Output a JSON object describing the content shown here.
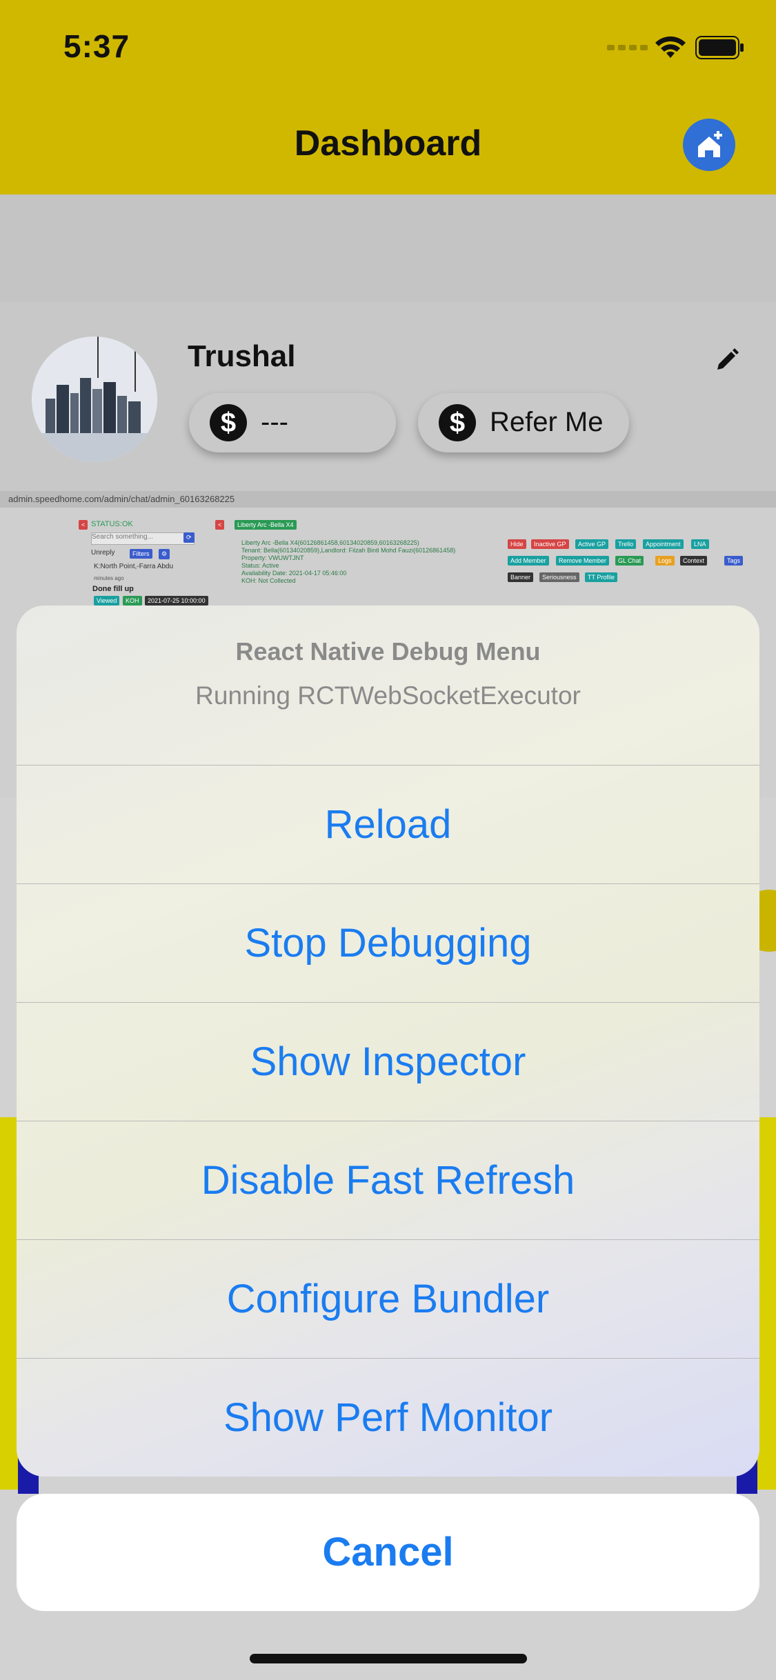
{
  "status_bar": {
    "time": "5:37"
  },
  "header": {
    "title": "Dashboard",
    "home_icon": "home-add-icon"
  },
  "profile": {
    "name": "Trushal",
    "balance_label": "---",
    "refer_label": "Refer Me",
    "currency_symbol": "$"
  },
  "embedded_browser": {
    "url": "admin.speedhome.com/admin/chat/admin_60163268225",
    "status": "STATUS:OK",
    "search_placeholder": "Search something...",
    "unreply": "Unreply",
    "filters": "Filters",
    "chat_name": "K:North Point,-Farra Abdu",
    "chat_time": "minutes ago",
    "chat_msg": "Done fill up",
    "badges": [
      "Viewed",
      "KOH",
      "2021-07-25 10:00:00"
    ],
    "room_tag": "Liberty Arc -Bella X4",
    "detail_lines": [
      "Liberty Arc -Bella X4(60126861458,60134020859,60163268225)",
      "Tenant: Bella(60134020859),Landlord: Filzah Binti Mohd Fauzi(60126861458)",
      "Property: VWUWTJNT",
      "Status: Active",
      "Availability Date: 2021-04-17 05:46:00",
      "KOH: Not Collected"
    ],
    "action_tags": [
      "Hide",
      "Inactive GP",
      "Active GP",
      "Trello",
      "Appointment",
      "LNA",
      "Add Member",
      "Remove Member",
      "GL Chat",
      "Logs",
      "Context",
      "Tags",
      "Banner",
      "Seriousness",
      "TT Profile"
    ]
  },
  "debug_menu": {
    "title": "React Native Debug Menu",
    "subtitle": "Running RCTWebSocketExecutor",
    "items": [
      "Reload",
      "Stop Debugging",
      "Show Inspector",
      "Disable Fast Refresh",
      "Configure Bundler",
      "Show Perf Monitor"
    ],
    "cancel": "Cancel"
  },
  "colors": {
    "header_yellow": "#d0b800",
    "ios_blue": "#1a7cf0",
    "home_button_blue": "#2f6fd6"
  }
}
